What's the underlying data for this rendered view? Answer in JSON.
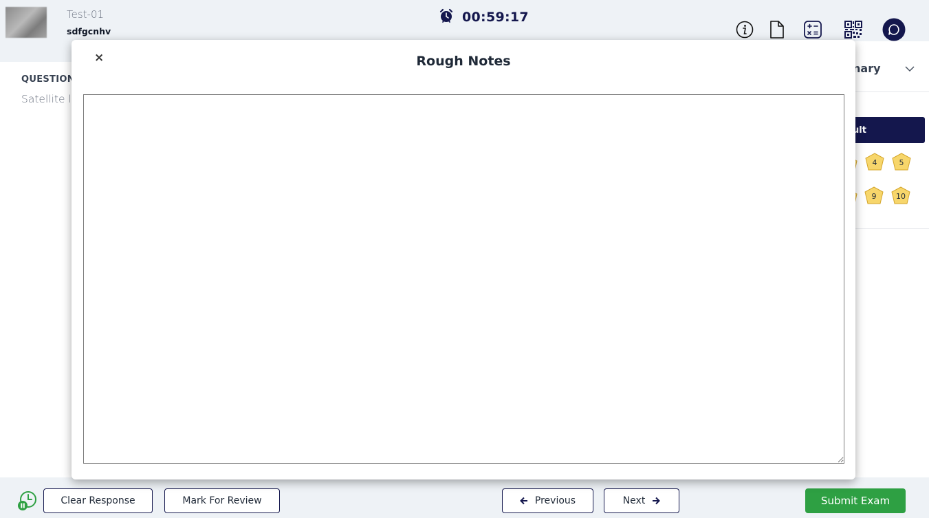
{
  "header": {
    "test_name": "Test-01",
    "user_name": "sdfgcnhv",
    "timer": "00:59:17"
  },
  "question": {
    "label": "QUESTION",
    "text": "Satellite la"
  },
  "right_panel": {
    "summary_label": "nary",
    "result_label": "ult",
    "badges_row1": [
      "4",
      "5"
    ],
    "badges_row2": [
      "9",
      "10"
    ]
  },
  "modal": {
    "close_label": "×",
    "title": "Rough Notes",
    "notes_value": ""
  },
  "footer": {
    "clear_label": "Clear Response",
    "review_label": "Mark For Review",
    "previous_label": "Previous",
    "next_label": "Next",
    "submit_label": "Submit Exam"
  },
  "colors": {
    "navy": "#14174d",
    "submit_green": "#2ea043",
    "badge_fill": "#f7d66b",
    "badge_stroke": "#d4a52a"
  },
  "icons": [
    "alarm-clock-icon",
    "info-icon",
    "document-icon",
    "calculator-icon",
    "qr-code-icon",
    "chat-icon",
    "chevron-down-icon",
    "pause-timer-icon",
    "arrow-left-icon",
    "arrow-right-icon"
  ]
}
